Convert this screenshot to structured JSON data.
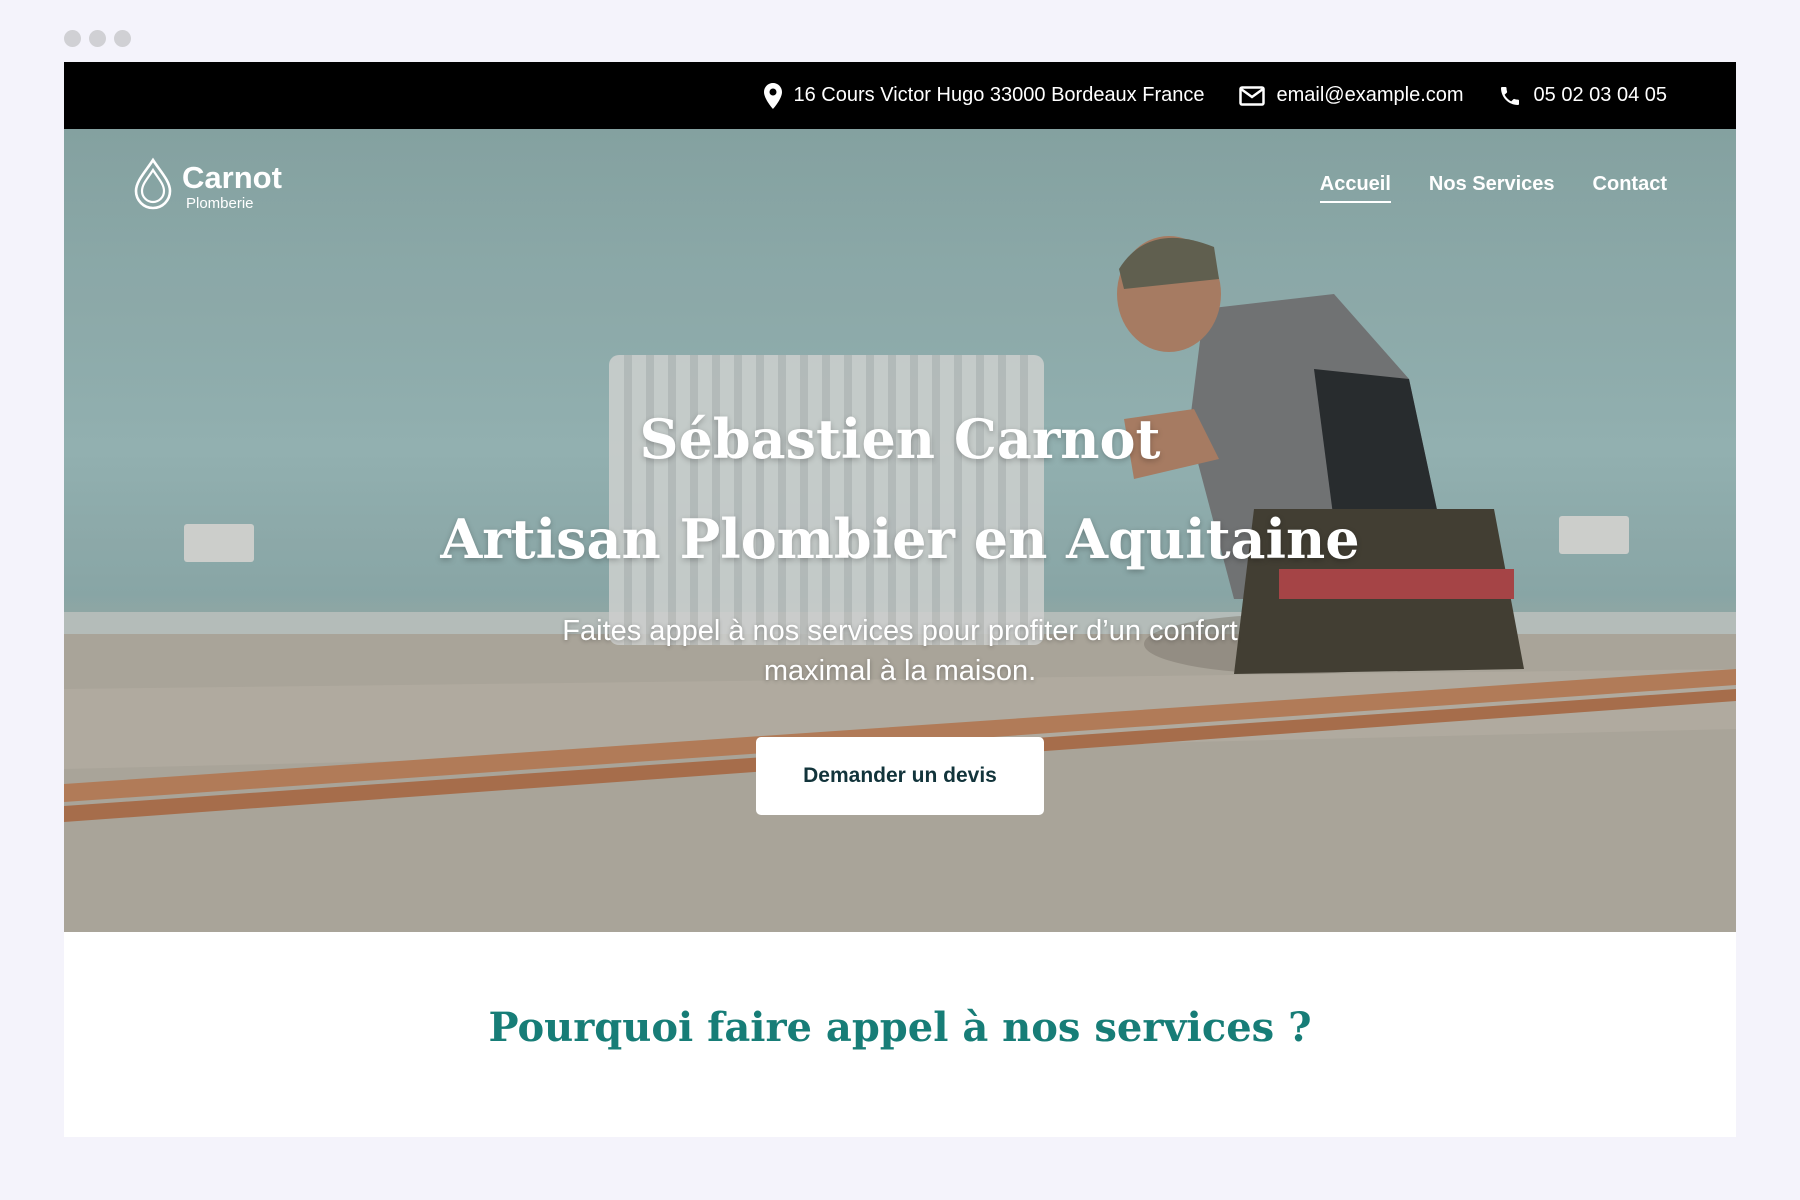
{
  "topbar": {
    "address": {
      "icon": "map-pin-icon",
      "text": "16 Cours Victor Hugo 33000 Bordeaux France"
    },
    "email": {
      "icon": "mail-icon",
      "text": "email@example.com"
    },
    "phone": {
      "icon": "phone-icon",
      "text": "05 02 03 04 05"
    }
  },
  "logo": {
    "icon": "water-drop-icon",
    "name": "Carnot",
    "subtitle": "Plomberie"
  },
  "nav": {
    "items": [
      {
        "label": "Accueil",
        "active": true
      },
      {
        "label": "Nos Services",
        "active": false
      },
      {
        "label": "Contact",
        "active": false
      }
    ]
  },
  "hero": {
    "title_line1": "Sébastien Carnot",
    "title_line2": "Artisan Plombier en Aquitaine",
    "description": "Faites appel à nos services pour profiter d’un confort maximal à la maison.",
    "cta_label": "Demander un devis"
  },
  "section": {
    "title": "Pourquoi faire appel à nos services ?"
  },
  "colors": {
    "topbar_bg": "#000000",
    "accent_teal": "#177d77",
    "cta_text": "#12343b",
    "page_bg": "#f4f3fb"
  }
}
